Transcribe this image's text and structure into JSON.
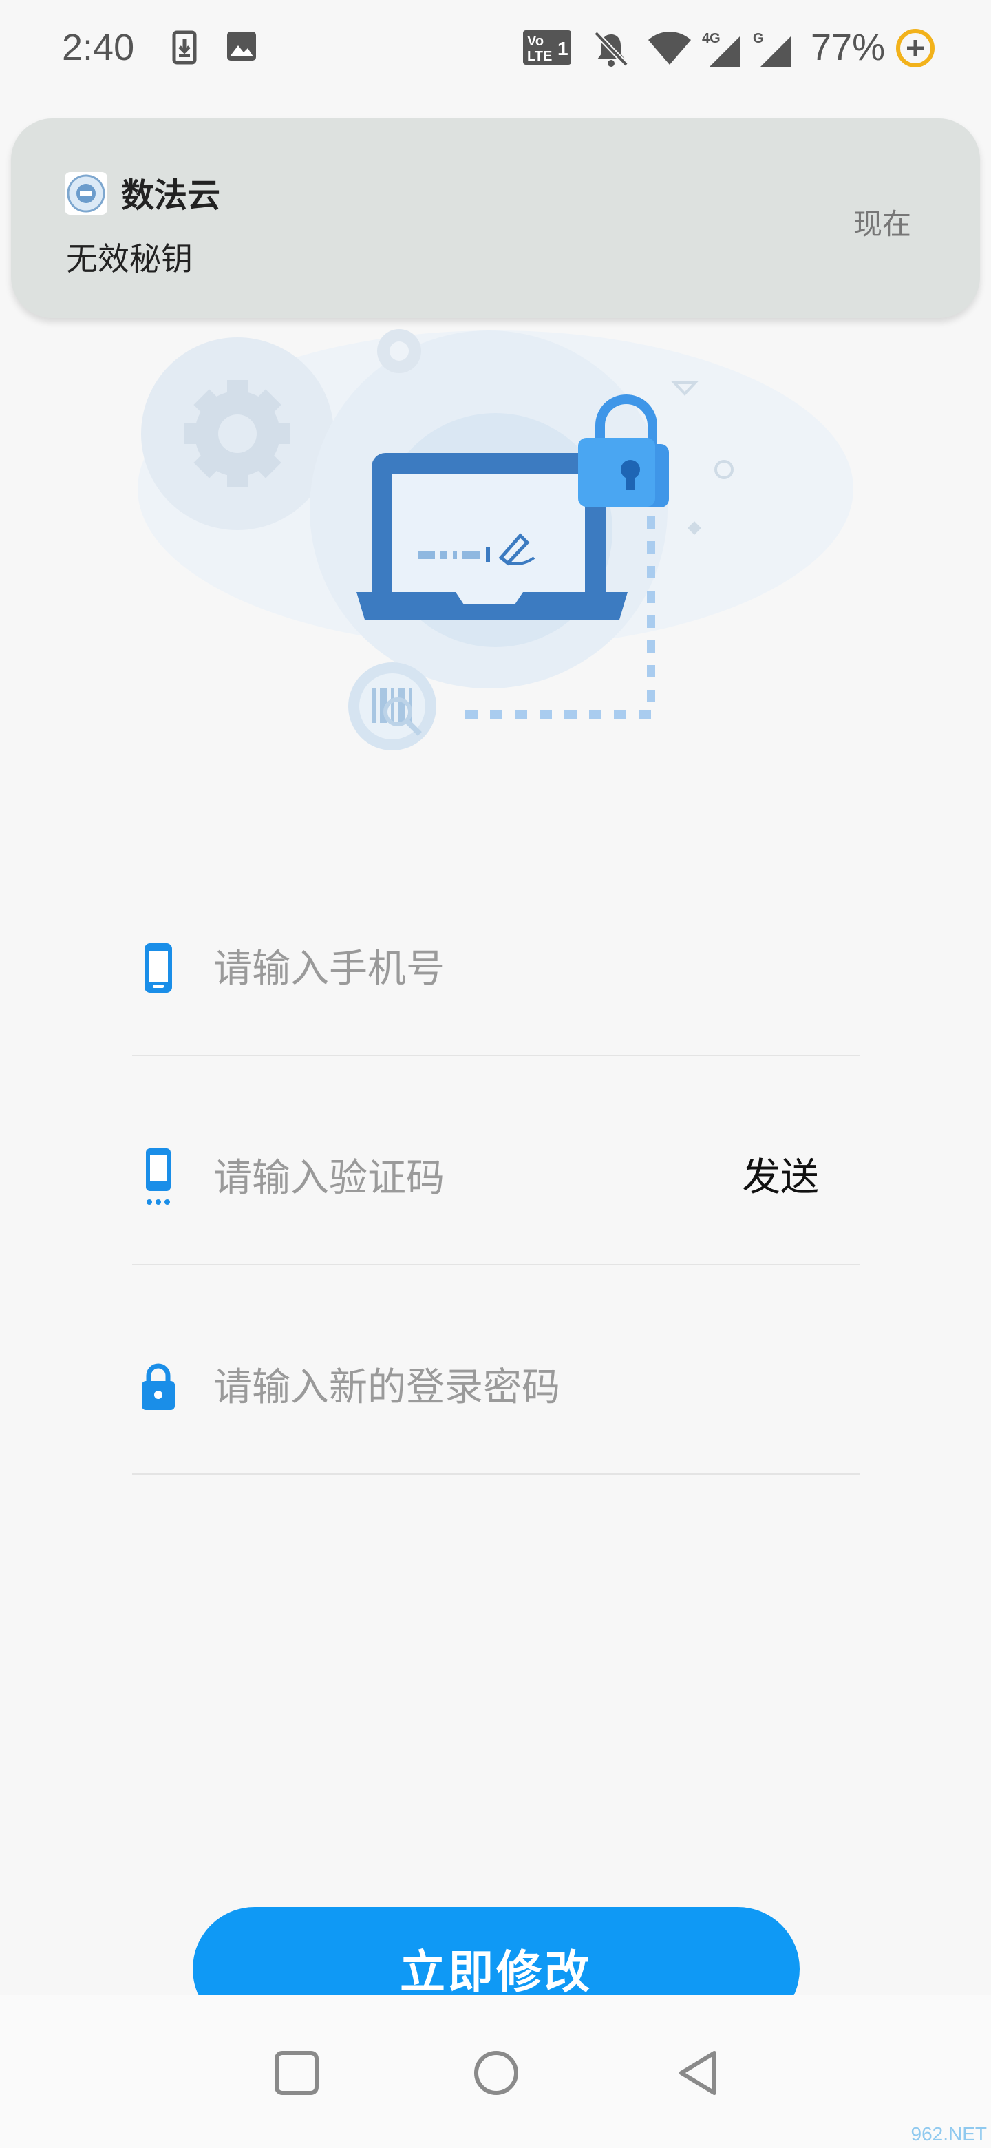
{
  "status_bar": {
    "time": "2:40",
    "battery": "77%",
    "icons": [
      "download-icon",
      "image-icon",
      "volte-icon",
      "mute-bell-icon",
      "wifi-icon",
      "signal-4g-icon",
      "signal-g-icon",
      "battery-saver-icon"
    ]
  },
  "notification": {
    "app_name": "数法云",
    "message": "无效秘钥",
    "time": "现在"
  },
  "form": {
    "phone_placeholder": "请输入手机号",
    "code_placeholder": "请输入验证码",
    "send_label": "发送",
    "password_placeholder": "请输入新的登录密码"
  },
  "submit_label": "立即修改",
  "colors": {
    "accent": "#0f99f5",
    "icon": "#1a8ee8"
  },
  "watermark": "962.NET"
}
